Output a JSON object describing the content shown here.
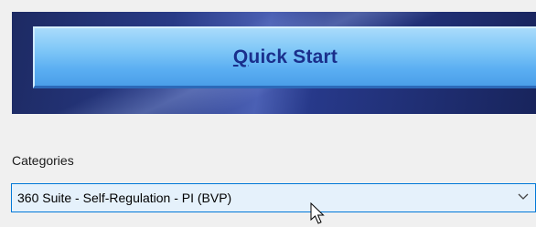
{
  "quick_start": {
    "mnemonic": "Q",
    "label_rest": "uick Start"
  },
  "categories": {
    "label": "Categories",
    "selected_value": "360 Suite - Self-Regulation - PI (BVP)"
  },
  "icons": {
    "dropdown": "chevron-down-icon",
    "pointer": "mouse-pointer-icon"
  },
  "colors": {
    "banner": "#283a86",
    "button": "#7fc7f7",
    "button_text": "#1a2f8c",
    "combo_border": "#0078d7",
    "combo_bg": "#e5f1fb"
  }
}
